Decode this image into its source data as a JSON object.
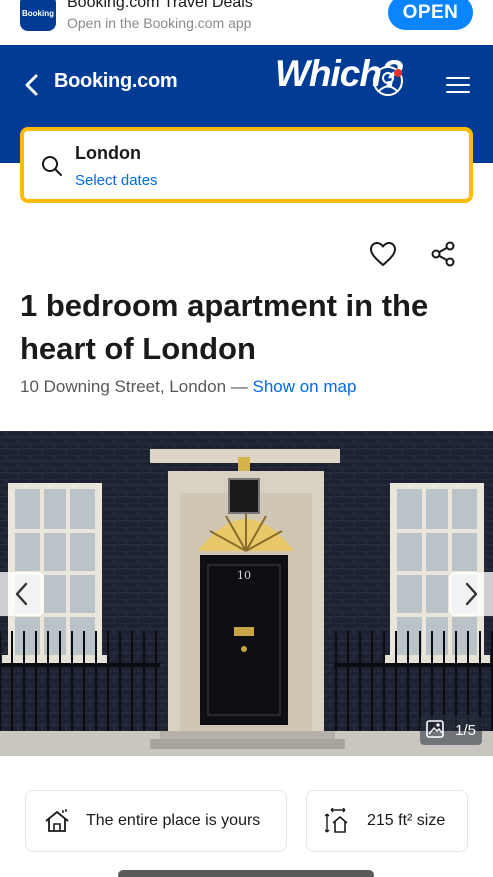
{
  "app_banner": {
    "icon_text": "Booking",
    "title": "Booking.com Travel Deals",
    "subtitle": "Open in the Booking.com app",
    "open_label": "OPEN"
  },
  "header": {
    "brand": "Booking.com",
    "which_logo": "Which?"
  },
  "search": {
    "destination": "London",
    "dates_label": "Select dates"
  },
  "property": {
    "title": "1 bedroom apartment in the heart of London",
    "address": "10 Downing Street, London — ",
    "map_link": "Show on map"
  },
  "gallery": {
    "counter": "1/5",
    "door_number": "10"
  },
  "features": [
    {
      "label": "The entire place is yours",
      "icon": "house-icon"
    },
    {
      "label": "215 ft² size",
      "icon": "size-icon"
    }
  ],
  "colors": {
    "brand_blue": "#003b95",
    "accent_yellow": "#febb02",
    "link_blue": "#006ce4",
    "ios_blue": "#0a84ff"
  }
}
